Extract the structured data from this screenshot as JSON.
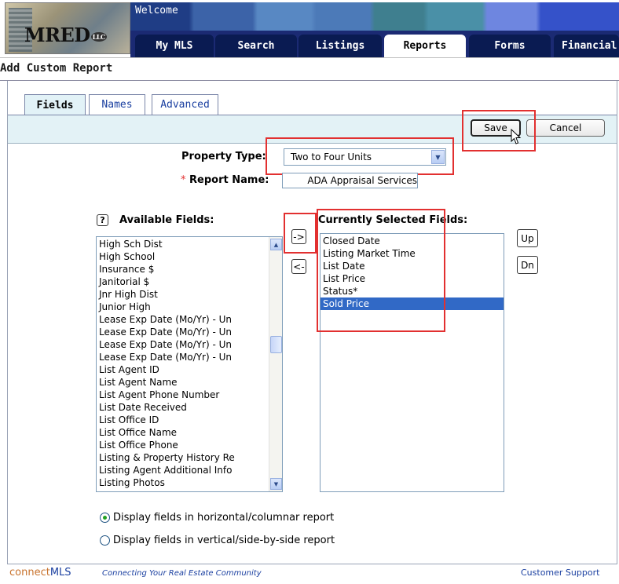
{
  "header": {
    "logo_text": "MRED",
    "logo_suffix": "LLC",
    "welcome": "Welcome",
    "tabs": [
      {
        "label": "My MLS"
      },
      {
        "label": "Search"
      },
      {
        "label": "Listings"
      },
      {
        "label": "Reports",
        "active": true
      },
      {
        "label": "Forms"
      },
      {
        "label": "Financial"
      }
    ]
  },
  "page": {
    "title": "Add Custom Report"
  },
  "subtabs": [
    {
      "label": "Fields",
      "active": true
    },
    {
      "label": "Names"
    },
    {
      "label": "Advanced"
    }
  ],
  "toolbar": {
    "save_label": "Save",
    "cancel_label": "Cancel"
  },
  "form": {
    "property_type_label": "Property Type:",
    "property_type_value": "Two to Four Units",
    "required_marker": "*",
    "report_name_label": "Report Name:",
    "report_name_value": "ADA Appraisal Services"
  },
  "available": {
    "help_label": "?",
    "label": "Available Fields:",
    "items": [
      "High Sch Dist",
      "High School",
      "Insurance $",
      "Janitorial $",
      "Jnr High Dist",
      "Junior High",
      "Lease Exp Date (Mo/Yr) - Un",
      "Lease Exp Date (Mo/Yr) - Un",
      "Lease Exp Date (Mo/Yr) - Un",
      "Lease Exp Date (Mo/Yr) - Un",
      "List Agent ID",
      "List Agent Name",
      "List Agent Phone Number",
      "List Date Received",
      "List Office ID",
      "List Office Name",
      "List Office Phone",
      "Listing & Property History Re",
      "Listing Agent Additional Info",
      "Listing Photos"
    ]
  },
  "move": {
    "add_label": "->",
    "remove_label": "<-"
  },
  "selected": {
    "label": "Currently Selected Fields:",
    "items": [
      "Closed Date",
      "Listing Market Time",
      "List Date",
      "List Price",
      "Status*",
      "Sold Price"
    ],
    "selected_item": "Sold Price",
    "up_label": "Up",
    "down_label": "Dn"
  },
  "display": {
    "horizontal_label": "Display fields in horizontal/columnar report",
    "vertical_label": "Display fields in vertical/side-by-side report",
    "selected": "horizontal"
  },
  "footer": {
    "brand_part1": "connect",
    "brand_part2": "MLS",
    "tagline": "Connecting Your Real Estate Community",
    "support": "Customer Support"
  },
  "colors": {
    "nav_dark": "#0a1b52",
    "highlight_red": "#e23030",
    "selection_blue": "#3169c6",
    "toolbar_bg": "#e3f2f6"
  }
}
